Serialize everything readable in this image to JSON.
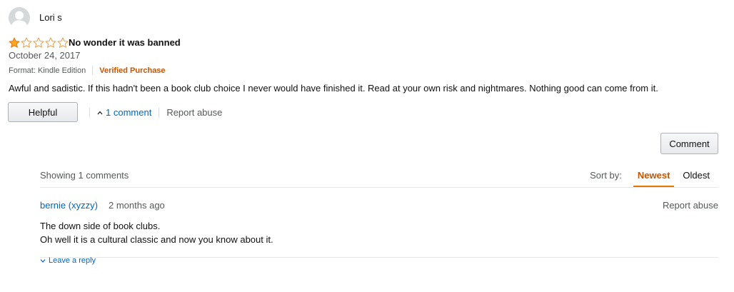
{
  "review": {
    "reviewer_name": "Lori s",
    "rating": 1,
    "rating_max": 5,
    "title": "No wonder it was banned",
    "date": "October 24, 2017",
    "format": "Format: Kindle Edition",
    "verified": "Verified Purchase",
    "body": "Awful and sadistic. If this hadn't been a book club choice I never would have finished it. Read at your own risk and nightmares. Nothing good can come from it.",
    "helpful_label": "Helpful",
    "comment_count_label": "1 comment",
    "report_label": "Report abuse",
    "comment_button_label": "Comment"
  },
  "comments": {
    "showing_label": "Showing 1 comments",
    "sort_label": "Sort by:",
    "sort_options": [
      "Newest",
      "Oldest"
    ],
    "sort_selected": "Newest",
    "items": [
      {
        "author": "bernie (xyzzy)",
        "time_ago": "2 months ago",
        "report_label": "Report abuse",
        "lines": [
          "The down side of book clubs.",
          "Oh well it is a cultural classic and now you know about it."
        ],
        "reply_label": "Leave a reply"
      }
    ]
  },
  "colors": {
    "link": "#0066c0",
    "accent": "#c45500",
    "star": "#ffa41c",
    "muted": "#565959"
  },
  "icons": {
    "avatar": "user-silhouette-icon",
    "star": "star-icon",
    "expand": "chevron-up-icon",
    "reply": "chevron-down-icon"
  }
}
